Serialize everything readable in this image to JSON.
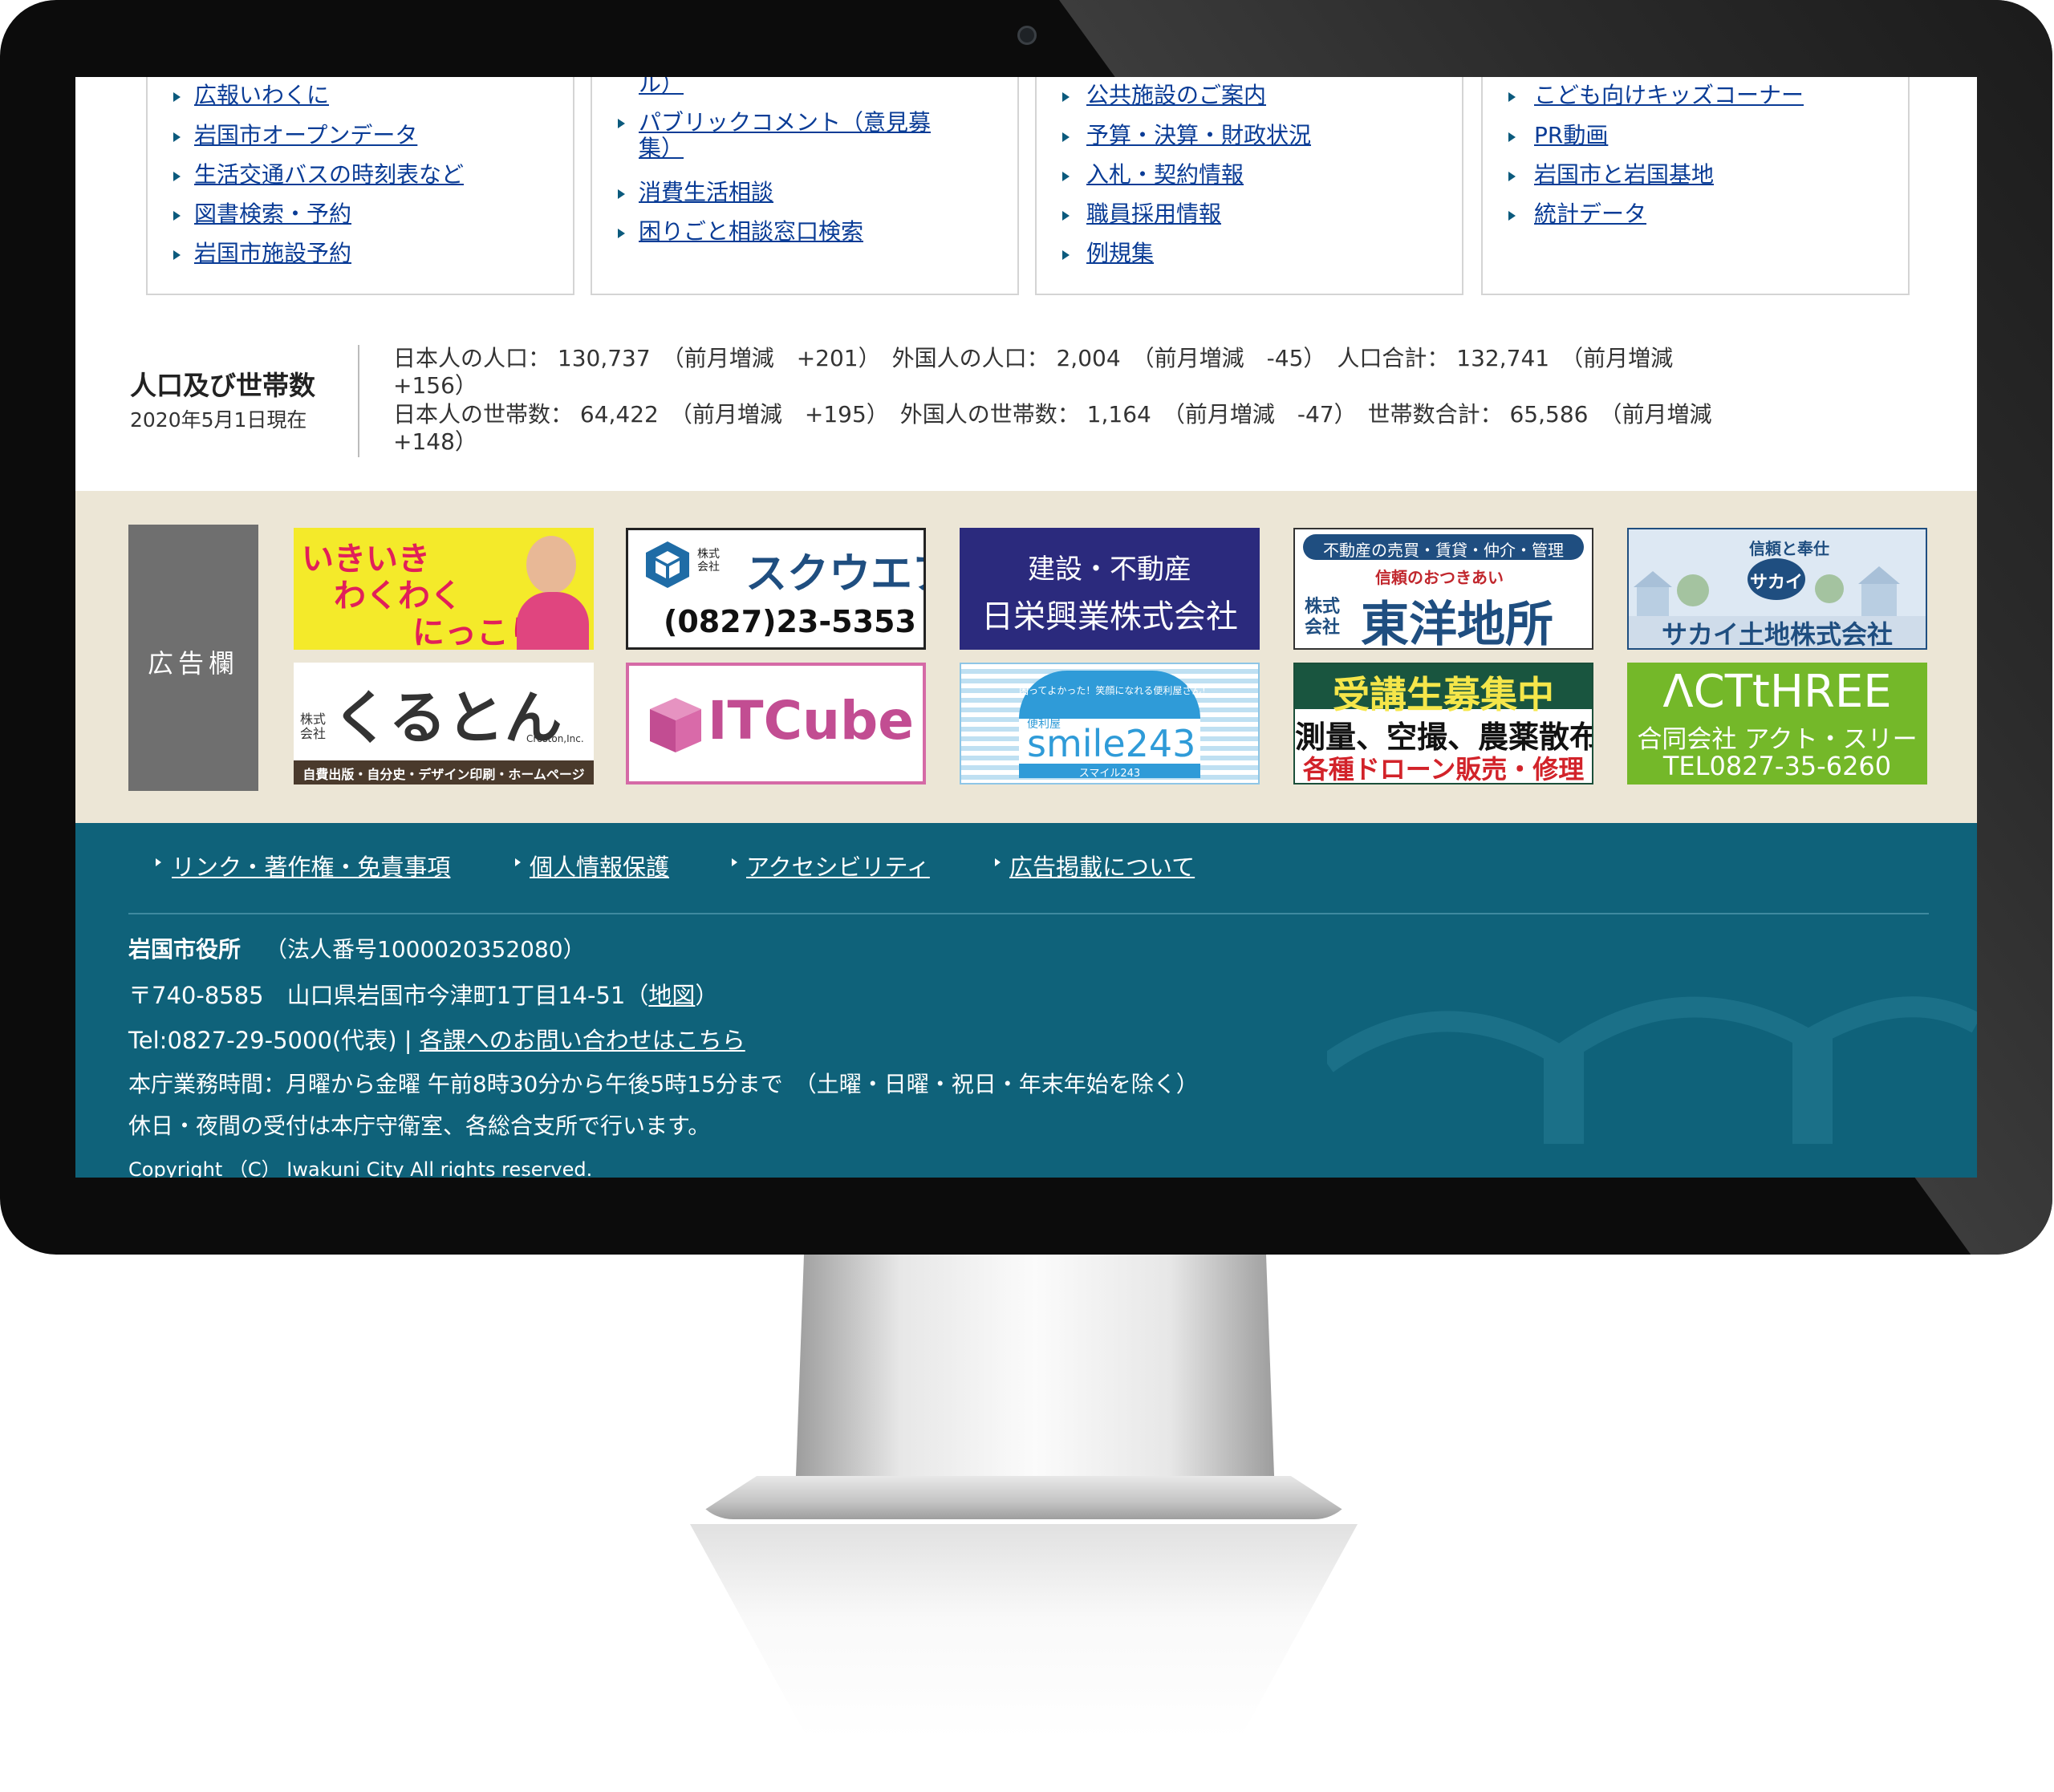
{
  "links": {
    "col1": [
      "広報いわくに",
      "岩国市オープンデータ",
      "生活交通バスの時刻表など",
      "図書検索・予約",
      "岩国市施設予約"
    ],
    "col2": [
      "ル）",
      "パブリックコメント（意見募",
      "集）",
      "消費生活相談",
      "困りごと相談窓口検索"
    ],
    "col3": [
      "公共施設のご案内",
      "予算・決算・財政状況",
      "入札・契約情報",
      "職員採用情報",
      "例規集"
    ],
    "col4": [
      "こども向けキッズコーナー",
      "PR動画",
      "岩国市と岩国基地",
      "統計データ"
    ]
  },
  "population": {
    "title": "人口及び世帯数",
    "date": "2020年5月1日現在",
    "line1": "日本人の人口：  130,737　（前月増減　+201）　外国人の人口：  2,004　（前月増減　-45）　人口合計：  132,741　（前月増減",
    "line1b": "+156）",
    "line2": "日本人の世帯数：  64,422　（前月増減　+195）　外国人の世帯数：  1,164　（前月増減　-47）　世帯数合計：  65,586　（前月増減",
    "line2b": "+148）"
  },
  "ads": {
    "label": "広告欄",
    "ad1": {
      "line1": "いきいき",
      "line2": "わくわく",
      "line3": "にっこり"
    },
    "ad2": {
      "kabu": "株式会社",
      "name": "スクウエア",
      "phone": "(0827)23-5353"
    },
    "ad3": {
      "line1": "建設・不動産",
      "line2": "日栄興業株式会社"
    },
    "ad4": {
      "top": "不動産の売買・賃貸・仲介・管理",
      "tag": "信頼のおつきあい",
      "kabu": "株式会社",
      "name": "東洋地所"
    },
    "ad5": {
      "tag": "信頼と奉仕",
      "mark": "サカイ",
      "name": "サカイ土地株式会社"
    },
    "ad6": {
      "kabu": "株式会社",
      "name": "くるとん",
      "roman": "Croston,Inc.",
      "bottom": "自費出版・自分史・デザイン印刷・ホームページ"
    },
    "ad7": {
      "name": "ITCube"
    },
    "ad8": {
      "tag": "困ってよかった！笑顔になれる便利屋さん！",
      "small": "便利屋",
      "name": "smile243",
      "kana": "スマイル243"
    },
    "ad9": {
      "line1": "受講生募集中",
      "line2": "測量、空撮、農薬散布",
      "line3": "各種ドローン販売・修理"
    },
    "ad10": {
      "line1": "ΛCTtHREE",
      "line2": "合同会社 アクト・スリー",
      "line3": "TEL0827-35-6260"
    }
  },
  "footer": {
    "nav": [
      "リンク・著作権・免責事項",
      "個人情報保護",
      "アクセシビリティ",
      "広告掲載について"
    ],
    "org": "岩国市役所",
    "corp_no": "（法人番号1000020352080）",
    "address": "〒740-8585　山口県岩国市今津町1丁目14-51（",
    "map_link": "地図",
    "address_end": "）",
    "tel": "Tel:0827-29-5000(代表) | ",
    "contact_link": "各課へのお問い合わせはこちら",
    "hours": "本庁業務時間：月曜から金曜 午前8時30分から午後5時15分まで　（土曜・日曜・祝日・年末年始を除く）",
    "night": "休日・夜間の受付は本庁守衛室、各総合支所で行います。",
    "copyright": "Copyright （C） Iwakuni City All rights reserved."
  },
  "colors": {
    "footer": "#0f627a",
    "ad_area": "#ece6d6",
    "link": "#0a3c96"
  }
}
